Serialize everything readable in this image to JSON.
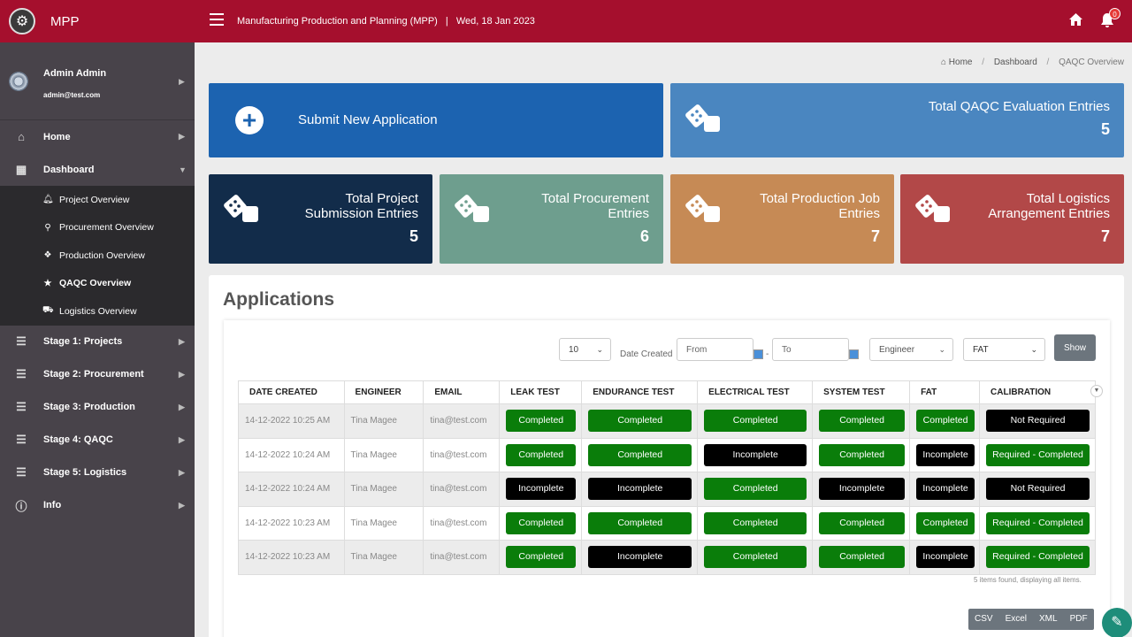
{
  "header": {
    "app_name": "MPP",
    "title": "Manufacturing Production and Planning (MPP)",
    "separator": "|",
    "date": "Wed, 18 Jan 2023",
    "notification_count": "0"
  },
  "sidebar": {
    "user_name": "Admin Admin",
    "user_email": "admin@test.com",
    "items": [
      {
        "label": "Home",
        "icon": "home-icon"
      },
      {
        "label": "Dashboard",
        "icon": "dashboard-icon"
      },
      {
        "label": "Stage 1: Projects",
        "icon": "menu-icon"
      },
      {
        "label": "Stage 2: Procurement",
        "icon": "menu-icon"
      },
      {
        "label": "Stage 3: Production",
        "icon": "menu-icon"
      },
      {
        "label": "Stage 4: QAQC",
        "icon": "menu-icon"
      },
      {
        "label": "Stage 5: Logistics",
        "icon": "menu-icon"
      },
      {
        "label": "Info",
        "icon": "info-icon"
      }
    ],
    "submenu": [
      {
        "label": "Project Overview",
        "icon": "bell-icon"
      },
      {
        "label": "Procurement Overview",
        "icon": "search-icon"
      },
      {
        "label": "Production Overview",
        "icon": "cubes-icon"
      },
      {
        "label": "QAQC Overview",
        "icon": "star-icon"
      },
      {
        "label": "Logistics Overview",
        "icon": "truck-icon"
      }
    ]
  },
  "breadcrumb": {
    "home": "Home",
    "dashboard": "Dashboard",
    "current": "QAQC Overview"
  },
  "cards": {
    "submit": {
      "label": "Submit New Application"
    },
    "qaqc": {
      "line1": "Total QAQC Evaluation Entries",
      "value": "5",
      "color": "#4a86c0"
    },
    "project": {
      "line1": "Total Project",
      "line2": "Submission Entries",
      "value": "5",
      "color": "#122c4a"
    },
    "procurement": {
      "line1": "Total Procurement",
      "line2": "Entries",
      "value": "6",
      "color": "#6e9e8e"
    },
    "production": {
      "line1": "Total Production Job",
      "line2": "Entries",
      "value": "7",
      "color": "#c68a55"
    },
    "logistics": {
      "line1": "Total Logistics",
      "line2": "Arrangement Entries",
      "value": "7",
      "color": "#b24848"
    }
  },
  "applications": {
    "title": "Applications",
    "page_size": "10",
    "date_label": "Date Created",
    "from_placeholder": "From",
    "to_placeholder": "To",
    "dash": "-",
    "role_filter": "Engineer",
    "test_filter": "FAT",
    "show_label": "Show",
    "columns": [
      "DATE CREATED",
      "ENGINEER",
      "EMAIL",
      "LEAK TEST",
      "ENDURANCE TEST",
      "ELECTRICAL TEST",
      "SYSTEM TEST",
      "FAT",
      "CALIBRATION"
    ],
    "rows": [
      {
        "date": "14-12-2022 10:25 AM",
        "engineer": "Tina Magee",
        "email": "tina@test.com",
        "leak": "Completed",
        "endurance": "Completed",
        "electrical": "Completed",
        "system": "Completed",
        "fat": "Completed",
        "calibration": "Not Required"
      },
      {
        "date": "14-12-2022 10:24 AM",
        "engineer": "Tina Magee",
        "email": "tina@test.com",
        "leak": "Completed",
        "endurance": "Completed",
        "electrical": "Incomplete",
        "system": "Completed",
        "fat": "Incomplete",
        "calibration": "Required - Completed"
      },
      {
        "date": "14-12-2022 10:24 AM",
        "engineer": "Tina Magee",
        "email": "tina@test.com",
        "leak": "Incomplete",
        "endurance": "Incomplete",
        "electrical": "Completed",
        "system": "Incomplete",
        "fat": "Incomplete",
        "calibration": "Not Required"
      },
      {
        "date": "14-12-2022 10:23 AM",
        "engineer": "Tina Magee",
        "email": "tina@test.com",
        "leak": "Completed",
        "endurance": "Completed",
        "electrical": "Completed",
        "system": "Completed",
        "fat": "Completed",
        "calibration": "Required - Completed"
      },
      {
        "date": "14-12-2022 10:23 AM",
        "engineer": "Tina Magee",
        "email": "tina@test.com",
        "leak": "Completed",
        "endurance": "Incomplete",
        "electrical": "Completed",
        "system": "Completed",
        "fat": "Incomplete",
        "calibration": "Required - Completed"
      }
    ],
    "footer": "5 items found, displaying all items.",
    "exports": [
      "CSV",
      "Excel",
      "XML",
      "PDF"
    ]
  },
  "colors": {
    "topbar": "#a50f2d",
    "sidebar": "#48434a",
    "completed": "#0a7d0a",
    "incomplete": "#000000"
  }
}
